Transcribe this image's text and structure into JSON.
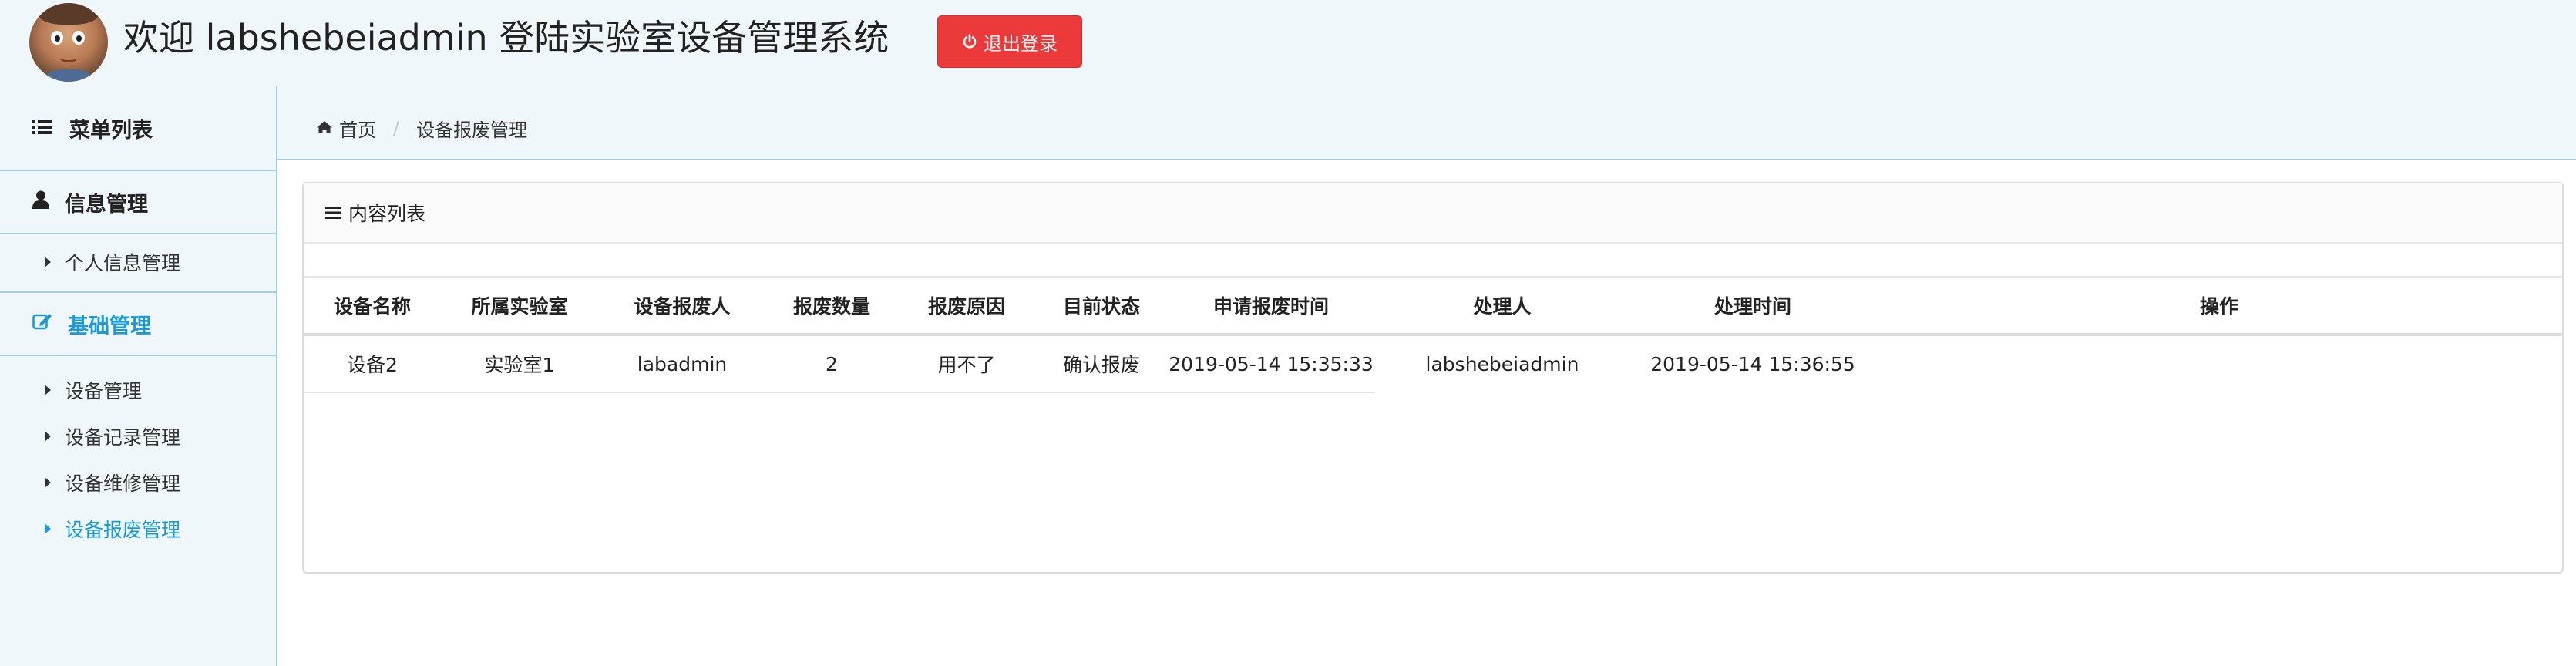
{
  "header": {
    "welcome_text": "欢迎 labshebeiadmin 登陆实验室设备管理系统",
    "logout_label": "退出登录"
  },
  "sidebar": {
    "menu_title": "菜单列表",
    "groups": [
      {
        "label": "信息管理",
        "icon": "user-icon",
        "items": [
          {
            "label": "个人信息管理"
          }
        ]
      },
      {
        "label": "基础管理",
        "icon": "edit-icon",
        "active": true,
        "items": [
          {
            "label": "设备管理"
          },
          {
            "label": "设备记录管理"
          },
          {
            "label": "设备维修管理"
          },
          {
            "label": "设备报废管理",
            "active": true
          }
        ]
      }
    ]
  },
  "breadcrumb": {
    "home": "首页",
    "current": "设备报废管理"
  },
  "panel": {
    "title": "内容列表"
  },
  "table": {
    "columns": [
      "设备名称",
      "所属实验室",
      "设备报废人",
      "报废数量",
      "报废原因",
      "目前状态",
      "申请报废时间",
      "处理人",
      "处理时间",
      "操作"
    ],
    "rows": [
      [
        "设备2",
        "实验室1",
        "labadmin",
        "2",
        "用不了",
        "确认报废",
        "2019-05-14 15:35:33",
        "labshebeiadmin",
        "2019-05-14 15:36:55",
        ""
      ]
    ]
  },
  "colors": {
    "accent": "#1b9ad6",
    "danger": "#ec3a3a",
    "background": "#f0f7fb"
  }
}
